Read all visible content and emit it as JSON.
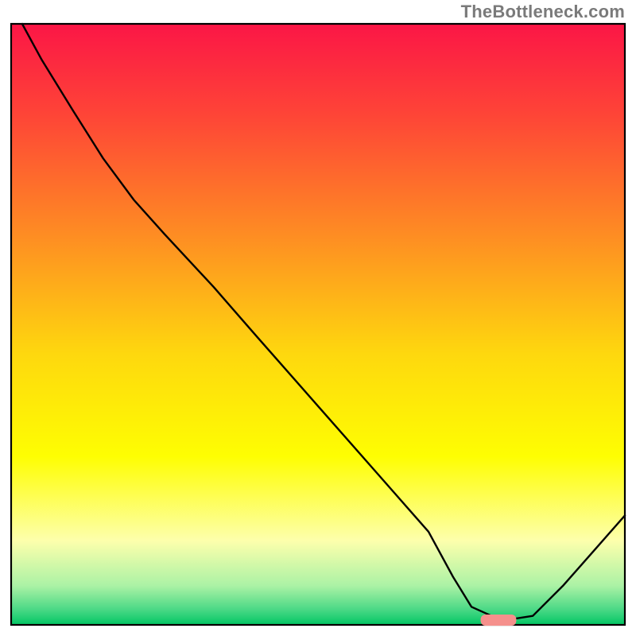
{
  "watermark": "TheBottleneck.com",
  "chart_data": {
    "type": "line",
    "title": "",
    "xlabel": "",
    "ylabel": "",
    "xlim": [
      0,
      100
    ],
    "ylim": [
      0,
      100
    ],
    "grid": false,
    "notes": "Background is a vertical rainbow gradient (red at top through orange/yellow to green at bottom). Chart has no ticks or axis labels. Values estimated from pixel positions.",
    "series": [
      {
        "name": "bottleneck-curve",
        "stroke": "#000000",
        "x": [
          1.8,
          5.0,
          10.0,
          15.0,
          20.0,
          25.0,
          33.0,
          40.0,
          50.0,
          60.0,
          68.0,
          72.0,
          75.0,
          80.0,
          85.0,
          90.0,
          95.0,
          100.0
        ],
        "y": [
          100.0,
          94.0,
          85.7,
          77.6,
          70.7,
          65.0,
          56.2,
          48.0,
          36.4,
          24.8,
          15.5,
          8.0,
          3.0,
          0.7,
          1.5,
          6.6,
          12.4,
          18.2
        ]
      }
    ],
    "highlight": {
      "name": "marker-segment",
      "color": "#f5908c",
      "x_range": [
        76.5,
        82.3
      ],
      "y": 0.8
    },
    "gradient_stops": [
      {
        "offset": 0.0,
        "color": "#fb1646"
      },
      {
        "offset": 0.15,
        "color": "#fe4437"
      },
      {
        "offset": 0.35,
        "color": "#fe8c23"
      },
      {
        "offset": 0.55,
        "color": "#fed80e"
      },
      {
        "offset": 0.72,
        "color": "#fefe02"
      },
      {
        "offset": 0.86,
        "color": "#fdffac"
      },
      {
        "offset": 0.935,
        "color": "#abf2a5"
      },
      {
        "offset": 0.975,
        "color": "#49d885"
      },
      {
        "offset": 1.0,
        "color": "#02c664"
      }
    ]
  }
}
